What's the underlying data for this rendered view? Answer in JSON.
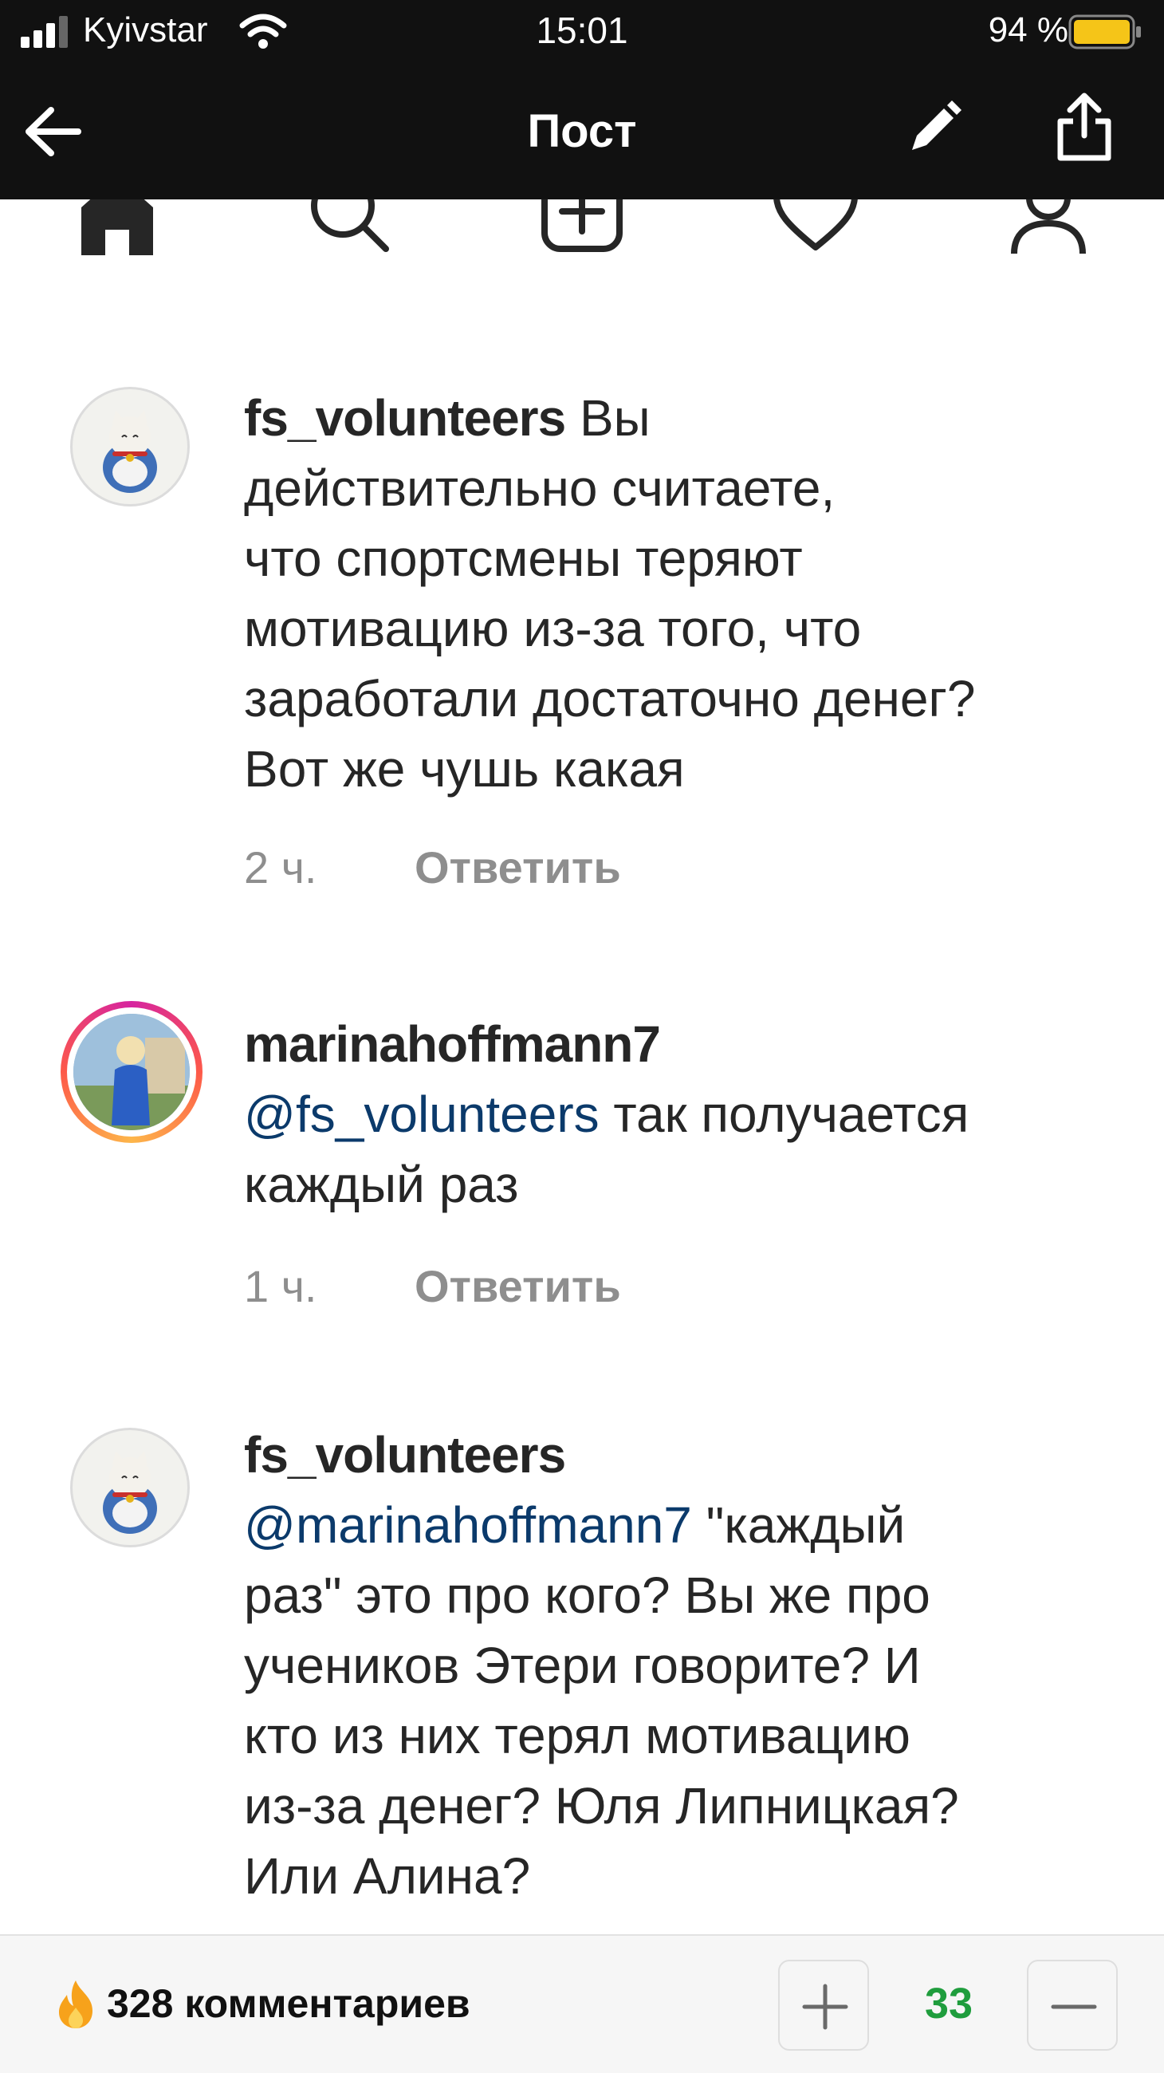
{
  "status_bar": {
    "carrier": "Kyivstar",
    "time": "15:01",
    "battery_percent": "94 %",
    "battery_color": "#f5c518"
  },
  "nav": {
    "title": "Пост",
    "back_icon": "arrow-left-icon",
    "edit_icon": "pencil-icon",
    "share_icon": "share-icon"
  },
  "tabbar": {
    "icons": [
      "home-icon",
      "search-icon",
      "add-post-icon",
      "heart-icon",
      "profile-icon"
    ]
  },
  "comments": [
    {
      "username": "fs_volunteers",
      "mention": "",
      "lines": [
        " Вы",
        "действительно считаете,",
        "что спортсмены теряют",
        "мотивацию из-за того, что",
        "заработали достаточно денег?",
        "Вот же чушь какая"
      ],
      "time": "2 ч.",
      "reply_label": "Ответить"
    },
    {
      "username": "marinahoffmann7",
      "mention": "@fs_volunteers",
      "lines": [
        " так получается",
        "каждый раз"
      ],
      "time": "1 ч.",
      "reply_label": "Ответить"
    },
    {
      "username": "fs_volunteers",
      "mention": "@marinahoffmann7",
      "lines": [
        " \"каждый",
        "раз\" это про кого?  Вы же про",
        "учеников Этери говорите? И",
        "кто из них терял мотивацию",
        "из-за денег? Юля Липницкая?",
        "Или Алина?"
      ]
    }
  ],
  "bottom_bar": {
    "comments_count_label": "328 комментариев",
    "score": "33",
    "score_color": "#1f9d3d",
    "plus_icon": "plus-icon",
    "minus_icon": "minus-icon",
    "fire_icon": "fire-icon"
  }
}
